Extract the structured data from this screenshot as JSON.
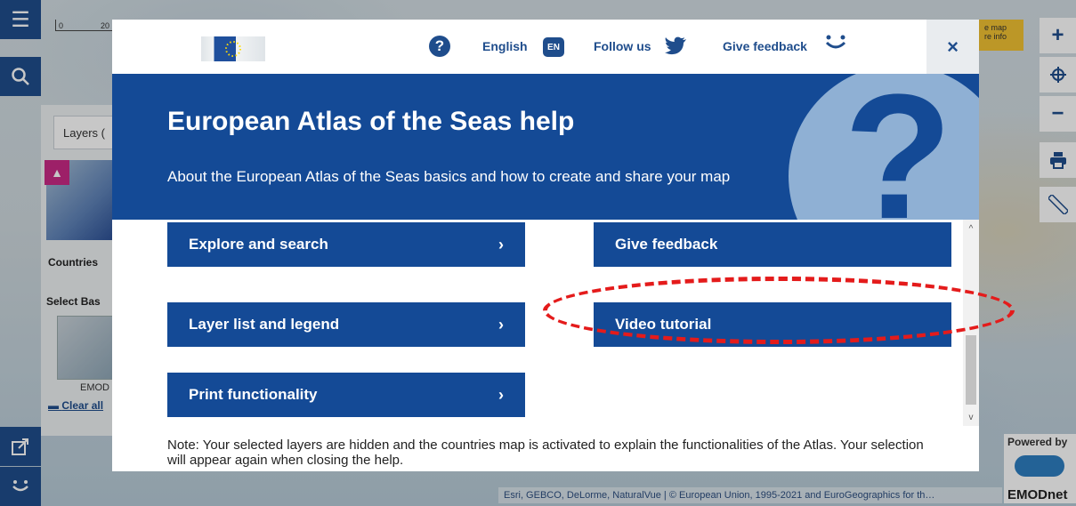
{
  "map": {
    "scale_ticks": [
      "0",
      "20"
    ],
    "layers_tab_label": "Layers (",
    "countries_label": "Countries",
    "select_base_label": "Select Bas",
    "emod_label": "EMOD",
    "clear_all_label": "Clear all",
    "yellow_button_line1": "e map",
    "yellow_button_line2": "re info",
    "attribution": "Esri, GEBCO, DeLorme, NaturalVue | © European Union, 1995-2021 and EuroGeographics for th…",
    "powered_by": "Powered by",
    "emodnet_label": "EMODnet"
  },
  "left_toolbar": [
    {
      "name": "menu-icon",
      "glyph": "☰"
    },
    {
      "name": "search-icon",
      "glyph": "⌕"
    },
    {
      "name": "share-icon",
      "glyph": "↗"
    },
    {
      "name": "smiley-icon",
      "glyph": "ᵕ"
    }
  ],
  "right_toolbar": [
    {
      "name": "zoom-in-icon",
      "glyph": "+"
    },
    {
      "name": "locate-icon",
      "glyph": "⌖"
    },
    {
      "name": "zoom-out-icon",
      "glyph": "−"
    },
    {
      "name": "print-icon",
      "glyph": "⎙"
    },
    {
      "name": "measure-icon",
      "glyph": "⟋"
    }
  ],
  "modal": {
    "topbar": {
      "help_glyph": "?",
      "language_label": "English",
      "language_code": "EN",
      "follow_label": "Follow us",
      "feedback_label": "Give feedback",
      "close_glyph": "×"
    },
    "banner": {
      "title": "European Atlas of the Seas help",
      "subtitle": "About the European Atlas of the Seas basics and how to create and share your map",
      "big_glyph": "?"
    },
    "buttons_left": [
      {
        "label": "Explore and search",
        "chevron": "›"
      },
      {
        "label": "Layer list and legend",
        "chevron": "›"
      },
      {
        "label": "Print functionality",
        "chevron": "›"
      }
    ],
    "buttons_right": [
      {
        "label": "Give feedback"
      },
      {
        "label": "Video tutorial"
      }
    ],
    "scroll_up": "^",
    "scroll_down": "v",
    "note": "Note: Your selected layers are hidden and the countries map is activated to explain the functionalities of the Atlas. Your selection will appear again when closing the help."
  },
  "colors": {
    "brand_blue": "#144a96",
    "annotation_red": "#e41b1b"
  }
}
